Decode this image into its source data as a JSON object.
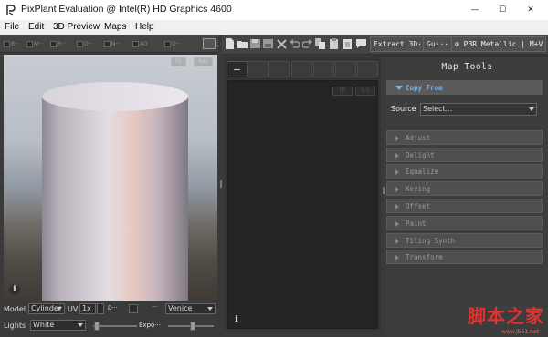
{
  "window": {
    "title": "PixPlant Evaluation @ Intel(R) HD Graphics 4600",
    "minimize_glyph": "—",
    "maximize_glyph": "☐",
    "close_glyph": "✕"
  },
  "menu": [
    {
      "label": "File"
    },
    {
      "label": "Edit"
    },
    {
      "label": "3D Preview"
    },
    {
      "label": "Maps"
    },
    {
      "label": "Help"
    }
  ],
  "left_toolbar": {
    "maps": [
      "B···",
      "M···",
      "R···",
      "D···",
      "N···",
      "AO",
      "O···"
    ]
  },
  "viewport": {
    "fit_label": "Fit",
    "res_label": "Res",
    "info_glyph": "i"
  },
  "controls": {
    "model_label": "Model",
    "model_value": "Cylinder",
    "uv_label": "UV",
    "uv_value": "1x",
    "d_label": "D···",
    "dots_label": "···",
    "environment_value": "Venice",
    "lights_label": "Lights",
    "lights_value": "White",
    "expo_label": "Expo···"
  },
  "main_toolbar": {
    "extract_label": "Extract 3D···",
    "gu_label": "Gu···",
    "material_label": "PBR Metallic | M+V"
  },
  "center_panel": {
    "fit_label": "Fit",
    "one_label": "1:1",
    "info_glyph": "i"
  },
  "map_tools": {
    "title": "Map Tools",
    "copy_from_label": "Copy From",
    "source_label": "Source",
    "source_value": "Select...",
    "sections": [
      "Adjust",
      "Delight",
      "Equalize",
      "Keying",
      "Offset",
      "Paint",
      "Tiling Synth",
      "Transform"
    ]
  },
  "watermark": {
    "text": "脚本之家",
    "url": "www.jb51.net"
  },
  "colors": {
    "app_bg": "#3a3a3a",
    "accent": "#7fb3e6",
    "panel": "#3d3d3d"
  }
}
